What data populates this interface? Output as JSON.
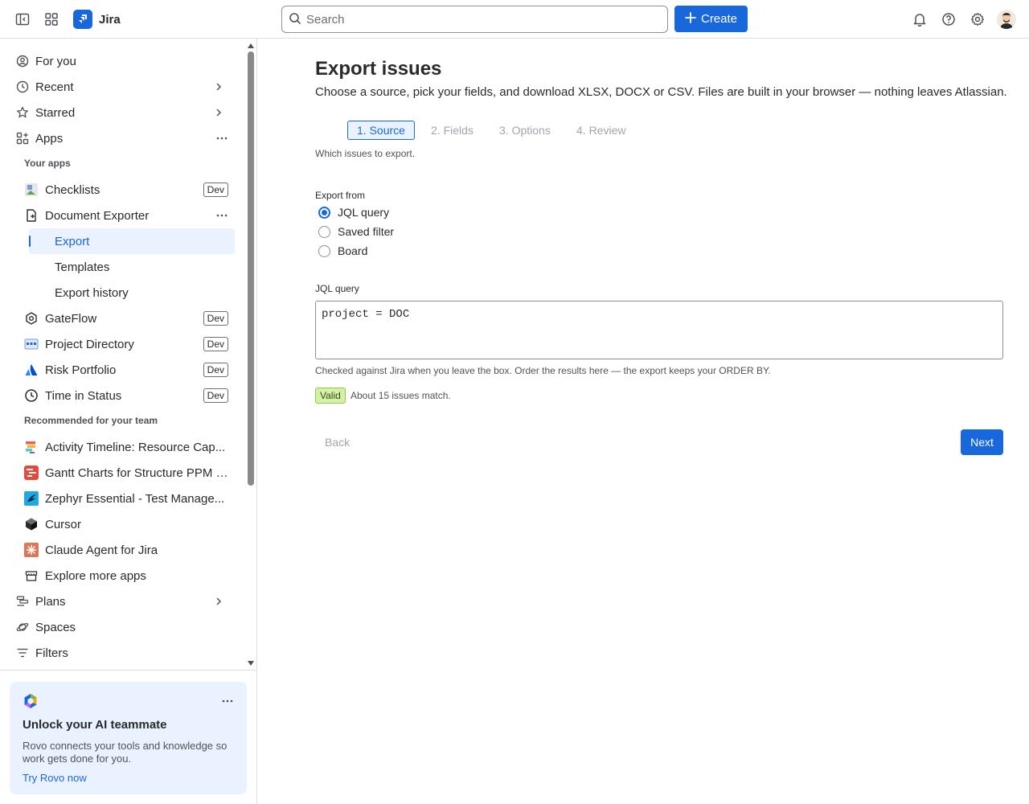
{
  "topbar": {
    "app_name": "Jira",
    "search_placeholder": "Search",
    "create_label": "Create"
  },
  "sidebar": {
    "nav": [
      {
        "label": "For you",
        "icon": "user-circle-icon"
      },
      {
        "label": "Recent",
        "icon": "clock-icon"
      },
      {
        "label": "Starred",
        "icon": "star-icon"
      },
      {
        "label": "Apps",
        "icon": "apps-icon"
      }
    ],
    "your_apps_heading": "Your apps",
    "apps": [
      {
        "label": "Checklists",
        "badge": "Dev",
        "icon": "checklists-icon"
      },
      {
        "label": "Document Exporter",
        "icon": "document-icon"
      },
      {
        "label": "GateFlow",
        "badge": "Dev",
        "icon": "hexagon-icon"
      },
      {
        "label": "Project Directory",
        "badge": "Dev",
        "icon": "directory-icon"
      },
      {
        "label": "Risk Portfolio",
        "badge": "Dev",
        "icon": "atlassian-icon"
      },
      {
        "label": "Time in Status",
        "badge": "Dev",
        "icon": "clock-icon"
      }
    ],
    "exporter_children": [
      {
        "label": "Export",
        "active": true
      },
      {
        "label": "Templates"
      },
      {
        "label": "Export history"
      }
    ],
    "recommended_heading": "Recommended for your team",
    "recommended": [
      {
        "label": "Activity Timeline: Resource Cap...",
        "icon": "activity-timeline-icon"
      },
      {
        "label": "Gantt Charts for Structure PPM -...",
        "icon": "gantt-icon"
      },
      {
        "label": "Zephyr Essential - Test Manage...",
        "icon": "zephyr-icon"
      },
      {
        "label": "Cursor",
        "icon": "cursor-cube-icon"
      },
      {
        "label": "Claude Agent for Jira",
        "icon": "claude-icon"
      },
      {
        "label": "Explore more apps",
        "icon": "store-icon"
      }
    ],
    "bottom_nav": [
      {
        "label": "Plans",
        "icon": "plans-icon"
      },
      {
        "label": "Spaces",
        "icon": "planet-icon"
      },
      {
        "label": "Filters",
        "icon": "filter-icon"
      }
    ],
    "promo": {
      "title": "Unlock your AI teammate",
      "body": "Rovo connects your tools and knowledge so work gets done for you.",
      "link": "Try Rovo now"
    }
  },
  "main": {
    "title": "Export issues",
    "description": "Choose a source, pick your fields, and download XLSX, DOCX or CSV. Files are built in your browser — nothing leaves Atlassian.",
    "steps": [
      "1. Source",
      "2. Fields",
      "3. Options",
      "4. Review"
    ],
    "active_step": 0,
    "step_hint": "Which issues to export.",
    "export_from_label": "Export from",
    "export_options": [
      {
        "label": "JQL query",
        "checked": true
      },
      {
        "label": "Saved filter",
        "checked": false
      },
      {
        "label": "Board",
        "checked": false
      }
    ],
    "jql_label": "JQL query",
    "jql_value": "project = DOC",
    "help_text": "Checked against Jira when you leave the box. Order the results here — the export keeps your ORDER BY.",
    "valid_badge": "Valid",
    "match_text": "About 15 issues match.",
    "back_label": "Back",
    "next_label": "Next"
  },
  "colors": {
    "brand": "#1868db",
    "selected_bg": "#e9f2fe",
    "valid_bg": "#d3f1a7"
  }
}
